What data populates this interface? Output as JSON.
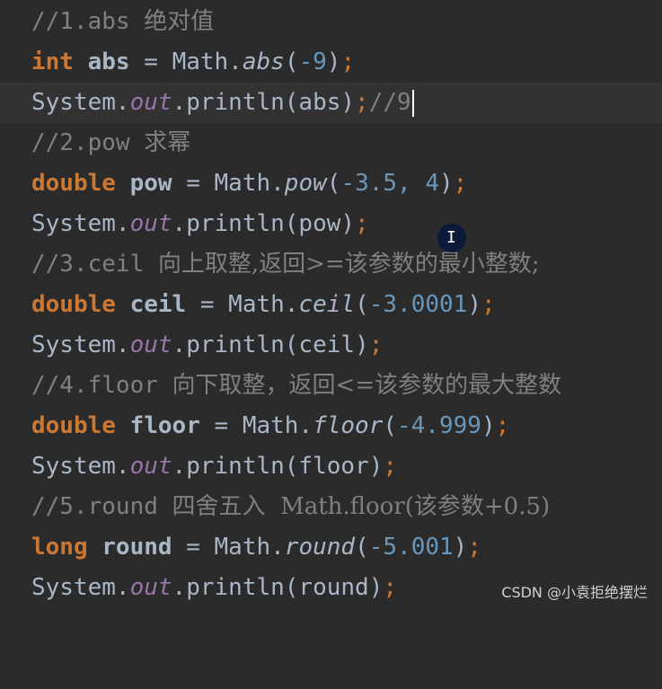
{
  "lines": [
    {
      "comment": "//1.abs ",
      "cjk": "绝对值"
    },
    {
      "kw": "int",
      "var": " abs",
      "op": " = ",
      "cls": "Math.",
      "method": "abs",
      "open": "(",
      "arg": "-9",
      "close": ")",
      "semi": ";"
    },
    {
      "pre": "System.",
      "field": "out",
      "post": ".println(abs)",
      "semi": ";",
      "tail": "//9"
    },
    {
      "comment": "//2.pow ",
      "cjk": "求幂"
    },
    {
      "kw": "double",
      "var": " pow",
      "op": " = ",
      "cls": "Math.",
      "method": "pow",
      "open": "(",
      "arg": "-3.5, 4",
      "close": ")",
      "semi": ";"
    },
    {
      "pre": "System.",
      "field": "out",
      "post": ".println(pow)",
      "semi": ";"
    },
    {
      "comment": "//3.ceil ",
      "cjk": "向上取整,返回>=该参数的最小整数;"
    },
    {
      "kw": "double",
      "var": " ceil",
      "op": " = ",
      "cls": "Math.",
      "method": "ceil",
      "open": "(",
      "arg": "-3.0001",
      "close": ")",
      "semi": ";"
    },
    {
      "pre": "System.",
      "field": "out",
      "post": ".println(ceil)",
      "semi": ";"
    },
    {
      "comment": "//4.floor ",
      "cjk": "向下取整，返回<=该参数的最大整数"
    },
    {
      "kw": "double",
      "var": " floor",
      "op": " = ",
      "cls": "Math.",
      "method": "floor",
      "open": "(",
      "arg": "-4.999",
      "close": ")",
      "semi": ";"
    },
    {
      "pre": "System.",
      "field": "out",
      "post": ".println(floor)",
      "semi": ";"
    },
    {
      "comment": "//5.round ",
      "cjk": "四舍五入  Math.floor(该参数+0.5)"
    },
    {
      "kw": "long",
      "var": " round",
      "op": " = ",
      "cls": "Math.",
      "method": "round",
      "open": "(",
      "arg": "-5.001",
      "close": ")",
      "semi": ";"
    },
    {
      "pre": "System.",
      "field": "out",
      "post": ".println(round)",
      "semi": ";"
    }
  ],
  "watermark": "CSDN @小袁拒绝摆烂",
  "mouse_cursor_glyph": "I",
  "colors": {
    "background": "#2b2b2b",
    "keyword": "#cc7832",
    "number": "#6897bb",
    "comment": "#808080",
    "field": "#9876aa",
    "text": "#a9b7c6"
  }
}
